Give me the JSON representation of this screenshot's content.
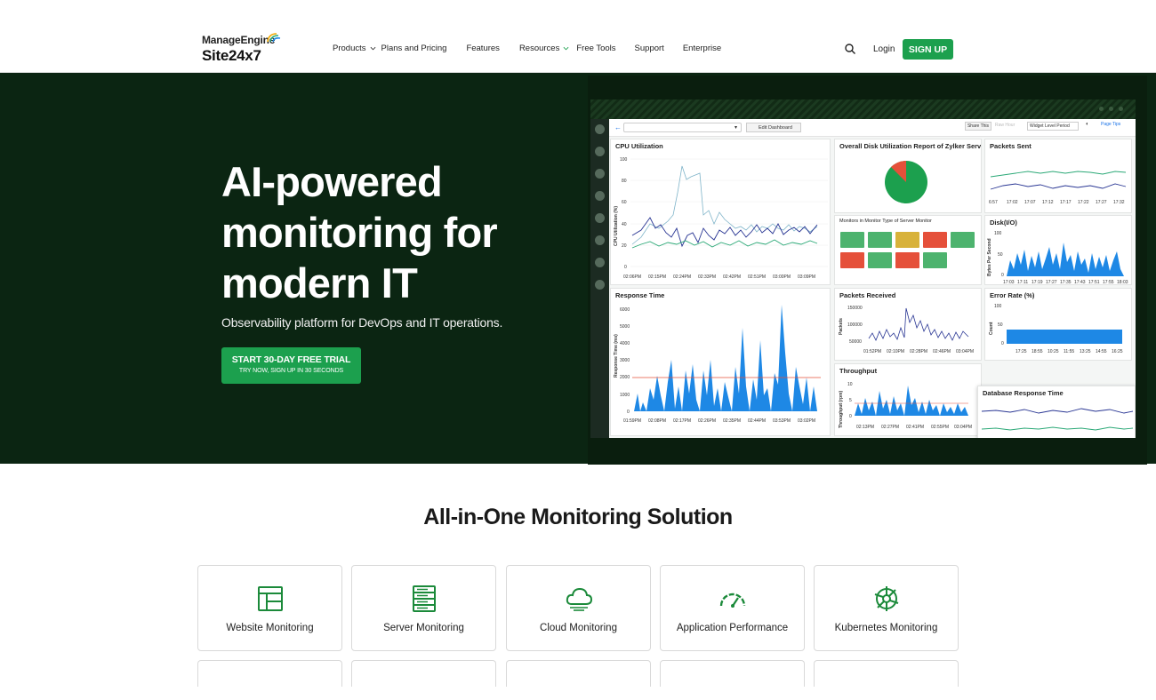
{
  "nav": {
    "brand_top": "ManageEngine",
    "brand_bottom": "Site24x7",
    "items": [
      {
        "label": "Products",
        "has_dropdown": true
      },
      {
        "label": "Plans and Pricing",
        "has_dropdown": false
      },
      {
        "label": "Features",
        "has_dropdown": false
      },
      {
        "label": "Resources",
        "has_dropdown": true
      },
      {
        "label": "Free Tools",
        "has_dropdown": false
      },
      {
        "label": "Support",
        "has_dropdown": false
      },
      {
        "label": "Enterprise",
        "has_dropdown": false
      }
    ],
    "login": "Login",
    "signup": "SIGN UP"
  },
  "hero": {
    "title_lines": [
      "AI-powered",
      "monitoring for",
      "modern IT"
    ],
    "subtitle": "Observability platform for DevOps and IT operations.",
    "cta_main": "START 30-DAY FREE TRIAL",
    "cta_sub": "TRY NOW, SIGN UP IN 30 SECONDS"
  },
  "dashboard": {
    "toolbar": {
      "edit": "Edit Dashboard",
      "share": "Share This",
      "raw": "Raw",
      "hour": "Hour",
      "period": "Widget Level Period",
      "tips": "Page Tips"
    },
    "widgets": {
      "cpu": {
        "title": "CPU Utilization",
        "ylabel": "CPU Utilization (%)",
        "yticks": [
          "100",
          "80",
          "60",
          "40",
          "20",
          "0"
        ],
        "xticks": [
          "02:06PM",
          "02:15PM",
          "02:24PM",
          "02:33PM",
          "02:42PM",
          "02:51PM",
          "03:00PM",
          "03:09PM"
        ]
      },
      "disk": {
        "title": "Overall Disk Utilization Report of Zylker Server"
      },
      "packets_sent": {
        "title": "Packets Sent",
        "xticks": [
          "6:57",
          "17:02",
          "17:07",
          "17:12",
          "17:17",
          "17:22",
          "17:27",
          "17:32"
        ]
      },
      "monitors": {
        "title": "Monitors in Monitor Type of Server Monitor",
        "tiles": [
          "#4db36e",
          "#4db36e",
          "#d8b23a",
          "#e5503a",
          "#4db36e",
          "#e5503a",
          "#4db36e",
          "#e5503a",
          "#4db36e"
        ]
      },
      "disk_io": {
        "title": "Disk(I/O)",
        "ylabel": "Bytes Per Second",
        "yticks": [
          "100",
          "50",
          "0"
        ],
        "xticks": [
          "17:03",
          "17:11",
          "17:19",
          "17:27",
          "17:35",
          "17:43",
          "17:51",
          "17:55",
          "18:03"
        ]
      },
      "response": {
        "title": "Response Time",
        "ylabel": "Response Time (ms)",
        "yticks": [
          "6000",
          "5000",
          "4000",
          "3000",
          "2000",
          "1000",
          "0"
        ],
        "xticks": [
          "01:59PM",
          "02:08PM",
          "02:17PM",
          "02:26PM",
          "02:35PM",
          "02:44PM",
          "03:53PM",
          "03:02PM"
        ]
      },
      "packets_recv": {
        "title": "Packets Received",
        "ylabel": "Packets",
        "yticks": [
          "150000",
          "100000",
          "50000"
        ],
        "xticks": [
          "01:52PM",
          "02:10PM",
          "02:28PM",
          "02:46PM",
          "03:04PM"
        ]
      },
      "error": {
        "title": "Error Rate (%)",
        "ylabel": "Count",
        "yticks": [
          "100",
          "50",
          "0"
        ],
        "xticks": [
          "17:25",
          "18:55",
          "10:25",
          "11:55",
          "13:25",
          "14:55",
          "16:25"
        ]
      },
      "throughput": {
        "title": "Throughput",
        "ylabel": "Throughput (rpm)",
        "yticks": [
          "10",
          "5",
          "0"
        ],
        "xticks": [
          "02:13PM",
          "02:27PM",
          "02:41PM",
          "02:55PM",
          "03:04PM"
        ]
      },
      "db_response": {
        "title": "Database Response Time"
      }
    }
  },
  "section": {
    "title": "All-in-One Monitoring Solution",
    "cards": [
      {
        "label": "Website Monitoring",
        "icon": "website-monitoring-icon"
      },
      {
        "label": "Server Monitoring",
        "icon": "server-monitoring-icon"
      },
      {
        "label": "Cloud Monitoring",
        "icon": "cloud-monitoring-icon"
      },
      {
        "label": "Application Performance",
        "icon": "application-performance-icon"
      },
      {
        "label": "Kubernetes Monitoring",
        "icon": "kubernetes-monitoring-icon"
      }
    ]
  },
  "colors": {
    "brand_green": "#1ca04e",
    "hero_bg": "#0b2512",
    "chart_blue": "#1e88e5",
    "chart_navy": "#283593",
    "chart_teal": "#2aa876"
  }
}
